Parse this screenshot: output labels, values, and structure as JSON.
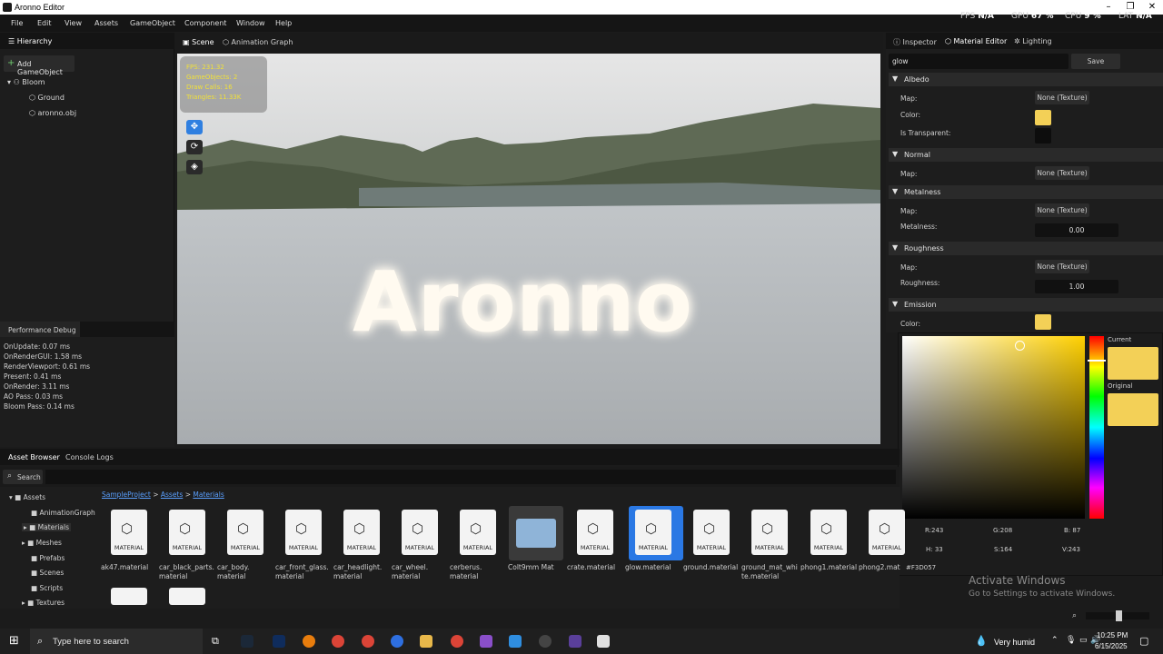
{
  "window": {
    "title": "Aronno Editor"
  },
  "menu": [
    "File",
    "Edit",
    "View",
    "Assets",
    "GameObject",
    "Component",
    "Window",
    "Help"
  ],
  "stats": {
    "fps_label": "FPS",
    "fps_value": "N/A",
    "gpu_label": "GPU",
    "gpu_value": "67 %",
    "cpu_label": "CPU",
    "cpu_value": "9 %",
    "lat_label": "LAT",
    "lat_value": "N/A"
  },
  "hierarchy": {
    "tab": "Hierarchy",
    "add_button": "Add GameObject",
    "root": "Bloom",
    "children": [
      "Ground",
      "aronno.obj"
    ]
  },
  "perf": {
    "title": "Performance Debug",
    "rows": [
      "OnUpdate: 0.07 ms",
      "OnRenderGUI: 1.58 ms",
      "RenderViewport: 0.61 ms",
      "Present: 0.41 ms",
      "OnRender: 3.11 ms",
      "AO Pass: 0.03 ms",
      "Bloom Pass: 0.14 ms"
    ]
  },
  "scene": {
    "tabs": [
      "Scene",
      "Animation Graph"
    ],
    "overlay": [
      "FPS: 231.32",
      "GameObjects: 2",
      "Draw Calls: 16",
      "Triangles: 11.33K"
    ],
    "scene_text": "Aronno"
  },
  "inspector": {
    "tabs": [
      "Inspector",
      "Material Editor",
      "Lighting"
    ],
    "material_name": "glow",
    "save_label": "Save",
    "albedo": {
      "title": "Albedo",
      "map_label": "Map:",
      "map_value": "None (Texture)",
      "color_label": "Color:",
      "transparent_label": "Is Transparent:",
      "color": "#F3D057"
    },
    "normal": {
      "title": "Normal",
      "map_label": "Map:",
      "map_value": "None (Texture)"
    },
    "metalness": {
      "title": "Metalness",
      "map_label": "Map:",
      "map_value": "None (Texture)",
      "value_label": "Metalness:",
      "value": "0.00"
    },
    "roughness": {
      "title": "Roughness",
      "map_label": "Map:",
      "map_value": "None (Texture)",
      "value_label": "Roughness:",
      "value": "1.00"
    },
    "emission": {
      "title": "Emission",
      "color_label": "Color:",
      "color": "#F3D057"
    }
  },
  "picker": {
    "current_label": "Current",
    "original_label": "Original",
    "r": "R:243",
    "g": "G:208",
    "b": "B: 87",
    "h": "H: 33",
    "s": "S:164",
    "v": "V:243",
    "hex": "#F3D057"
  },
  "assets": {
    "tabs": [
      "Asset Browser",
      "Console Logs"
    ],
    "search_label": "Search",
    "breadcrumb": [
      "SampleProject",
      "Assets",
      "Materials"
    ],
    "folders": [
      "Assets",
      "AnimationGraph",
      "Materials",
      "Meshes",
      "Prefabs",
      "Scenes",
      "Scripts",
      "Textures"
    ],
    "tile_text": "MATERIAL",
    "items": [
      {
        "line1": "ak47.material",
        "line2": ""
      },
      {
        "line1": "car_black_parts.",
        "line2": "material"
      },
      {
        "line1": "car_body.",
        "line2": "material"
      },
      {
        "line1": "car_front_glass.",
        "line2": "material"
      },
      {
        "line1": "car_headlight.",
        "line2": "material"
      },
      {
        "line1": "car_wheel.",
        "line2": "material"
      },
      {
        "line1": "cerberus.",
        "line2": "material"
      },
      {
        "line1": "Colt9mm Mat",
        "line2": ""
      },
      {
        "line1": "crate.material",
        "line2": ""
      },
      {
        "line1": "glow.material",
        "line2": ""
      },
      {
        "line1": "ground.material",
        "line2": ""
      },
      {
        "line1": "ground_mat_whi",
        "line2": "te.material"
      },
      {
        "line1": "phong1.material",
        "line2": ""
      },
      {
        "line1": "phong2.mat",
        "line2": ""
      }
    ]
  },
  "watermark": {
    "line1": "Activate Windows",
    "line2": "Go to Settings to activate Windows."
  },
  "taskbar": {
    "search_placeholder": "Type here to search",
    "weather": "Very humid",
    "time": "10:25 PM",
    "date": "6/15/2025"
  }
}
